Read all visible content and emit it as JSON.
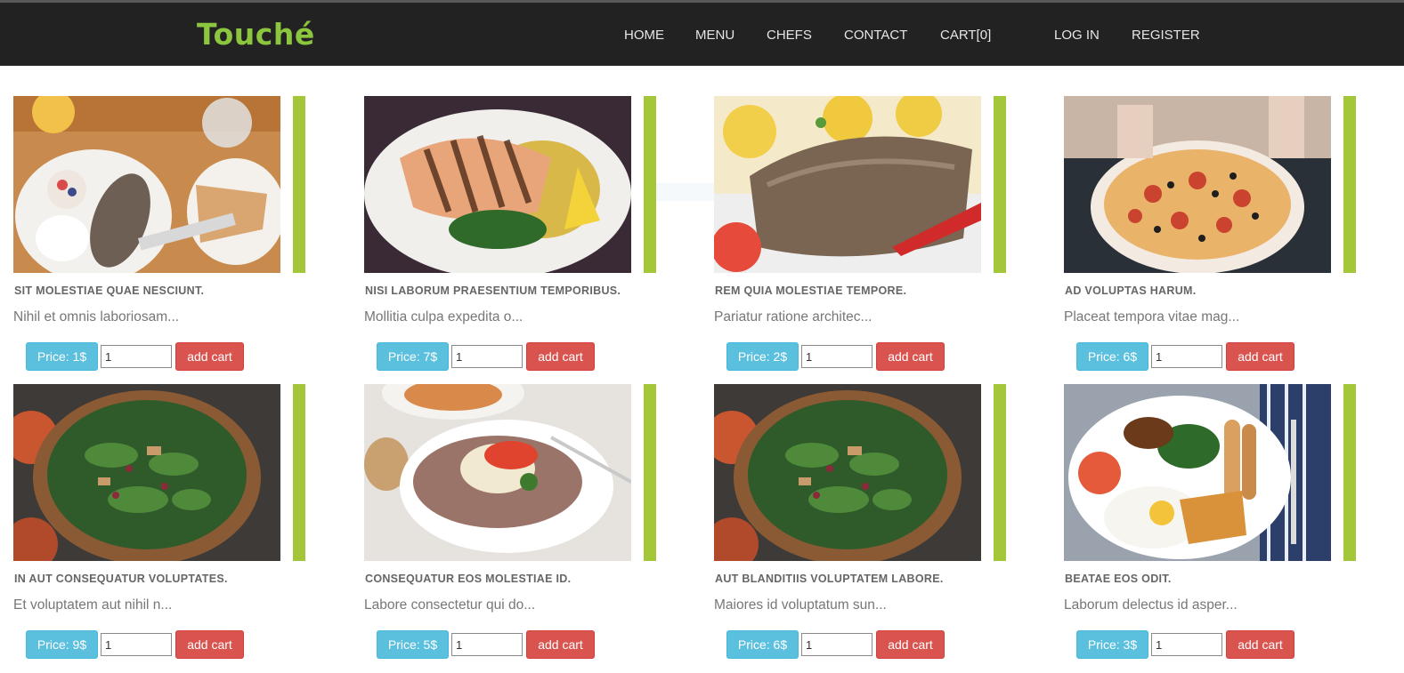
{
  "brand": "Touché",
  "nav": {
    "home": "HOME",
    "menu": "MENU",
    "chefs": "CHEFS",
    "contact": "CONTACT",
    "cart": "CART[0]",
    "login": "LOG IN",
    "register": "REGISTER"
  },
  "colors": {
    "navbar": "#222222",
    "brand": "#8cc63f",
    "accent_bar": "#a4c639",
    "price_button": "#5bc0de",
    "cart_button": "#d9534f"
  },
  "products": [
    {
      "title": "SIT MOLESTIAE QUAE NESCIUNT.",
      "desc": "Nihil et omnis laboriosam...",
      "price": "Price: 1$",
      "qty": "1",
      "cart": "add cart",
      "image": "steak-breakfast-plate-photo"
    },
    {
      "title": "NISI LABORUM PRAESENTIUM TEMPORIBUS.",
      "desc": "Mollitia culpa expedita o...",
      "price": "Price: 7$",
      "qty": "1",
      "cart": "add cart",
      "image": "grilled-salmon-photo"
    },
    {
      "title": "REM QUIA MOLESTIAE TEMPORE.",
      "desc": "Pariatur ratione architec...",
      "price": "Price: 2$",
      "qty": "1",
      "cart": "add cart",
      "image": "roast-beef-potatoes-photo"
    },
    {
      "title": "AD VOLUPTAS HARUM.",
      "desc": "Placeat tempora vitae mag...",
      "price": "Price: 6$",
      "qty": "1",
      "cart": "add cart",
      "image": "pizza-photo"
    },
    {
      "title": "IN AUT CONSEQUATUR VOLUPTATES.",
      "desc": "Et voluptatem aut nihil n...",
      "price": "Price: 9$",
      "qty": "1",
      "cart": "add cart",
      "image": "salad-bowl-photo"
    },
    {
      "title": "CONSEQUATUR EOS MOLESTIAE ID.",
      "desc": "Labore consectetur qui do...",
      "price": "Price: 5$",
      "qty": "1",
      "cart": "add cart",
      "image": "beef-carpaccio-photo"
    },
    {
      "title": "AUT BLANDITIIS VOLUPTATEM LABORE.",
      "desc": "Maiores id voluptatum sun...",
      "price": "Price: 6$",
      "qty": "1",
      "cart": "add cart",
      "image": "salad-bowl-photo"
    },
    {
      "title": "BEATAE EOS ODIT.",
      "desc": "Laborum delectus id asper...",
      "price": "Price: 3$",
      "qty": "1",
      "cart": "add cart",
      "image": "english-breakfast-photo"
    }
  ]
}
